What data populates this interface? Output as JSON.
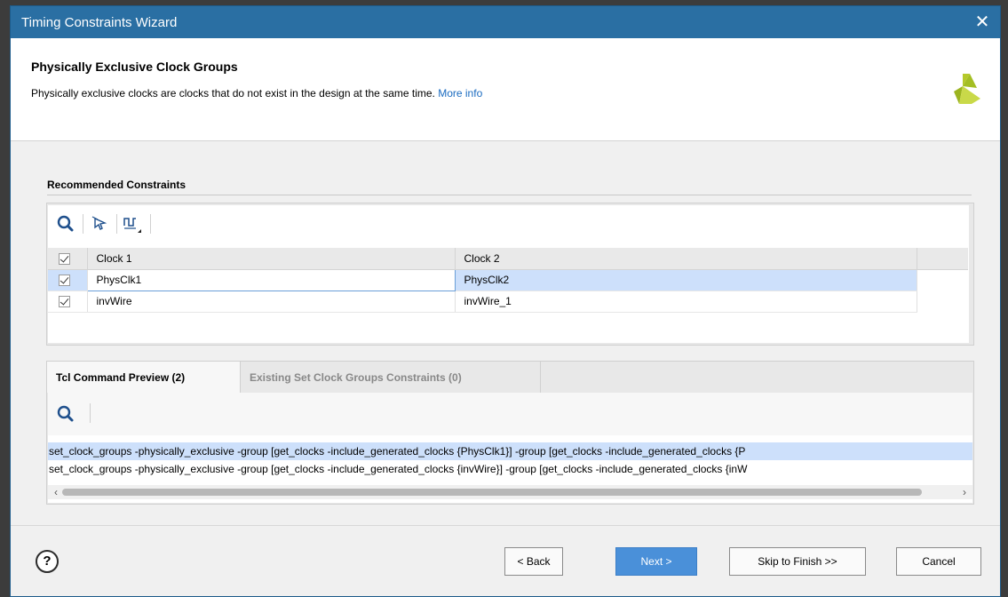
{
  "window": {
    "title": "Timing Constraints Wizard",
    "close_glyph": "✕"
  },
  "header": {
    "title": "Physically Exclusive Clock Groups",
    "description": "Physically exclusive clocks are clocks that do not exist in the design at the same time.",
    "more_info": "More info"
  },
  "section": {
    "title": "Recommended Constraints"
  },
  "table": {
    "columns": [
      "Clock 1",
      "Clock 2"
    ],
    "rows": [
      {
        "checked": true,
        "clock1": "PhysClk1",
        "clock2": "PhysClk2",
        "selected": true
      },
      {
        "checked": true,
        "clock1": "invWire",
        "clock2": "invWire_1",
        "selected": false
      }
    ]
  },
  "tabs": [
    {
      "label": "Tcl Command Preview (2)",
      "active": true
    },
    {
      "label": "Existing Set Clock Groups Constraints (0)",
      "active": false
    }
  ],
  "tcl": {
    "lines": [
      "set_clock_groups -physically_exclusive -group [get_clocks -include_generated_clocks {PhysClk1}] -group [get_clocks -include_generated_clocks {P",
      "set_clock_groups -physically_exclusive -group [get_clocks -include_generated_clocks {invWire}] -group [get_clocks -include_generated_clocks {inW"
    ]
  },
  "footer": {
    "help": "?",
    "back": "< Back",
    "next": "Next >",
    "skip": "Skip to Finish >>",
    "cancel": "Cancel"
  },
  "icons": [
    "search-icon",
    "select-cursor-icon",
    "clock-waveform-icon",
    "help-icon",
    "xilinx-logo-icon"
  ],
  "colors": {
    "titlebar": "#2a6fa3",
    "selection": "#cde0fb",
    "primary_button": "#4a90d9",
    "link": "#1a6bc0"
  }
}
